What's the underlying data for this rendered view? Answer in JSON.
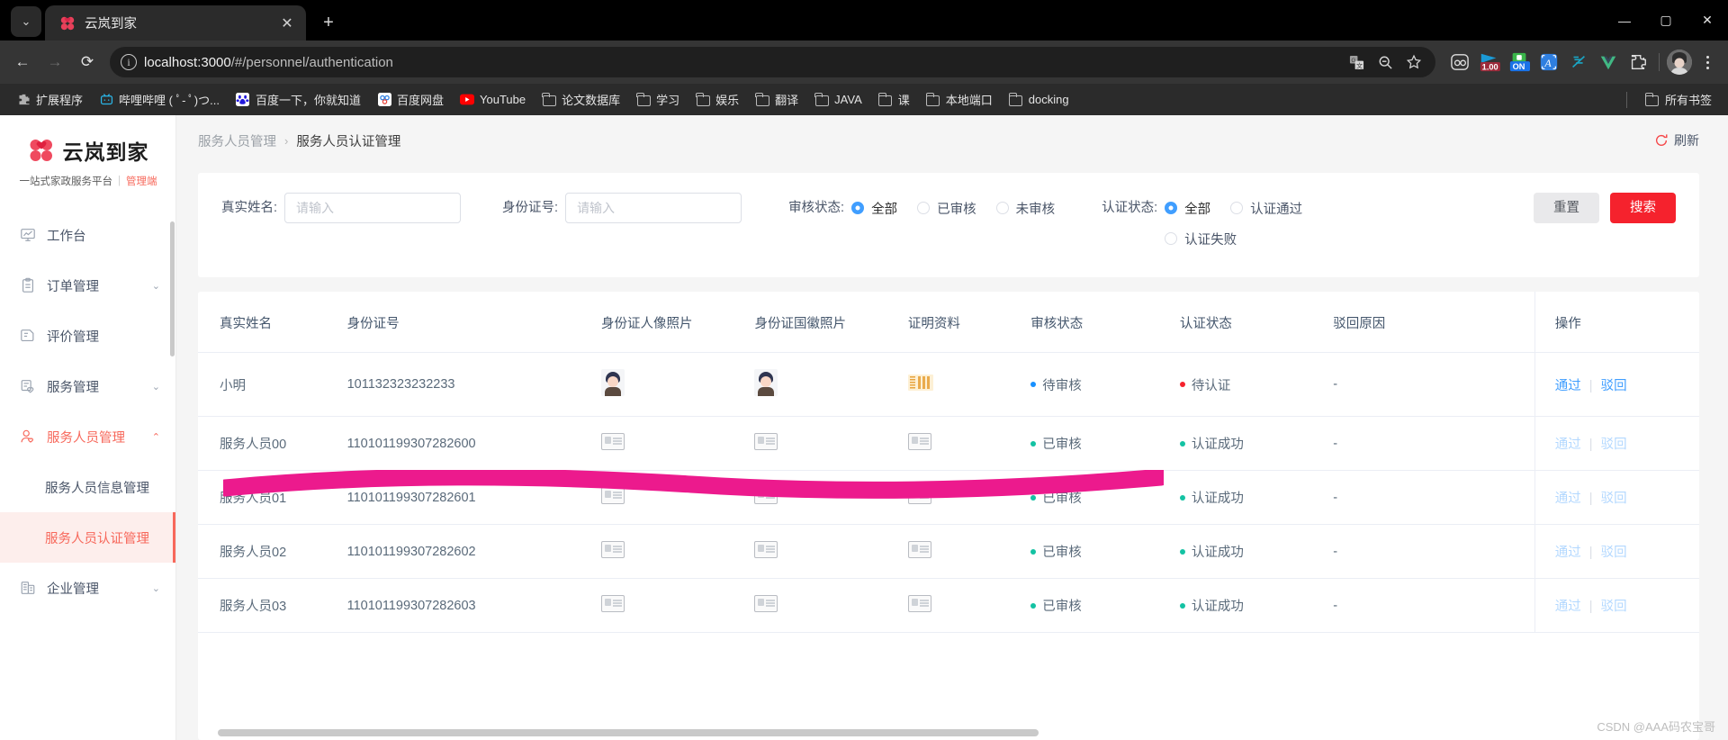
{
  "browser": {
    "tab": {
      "title": "云岚到家",
      "favicon": "clover-icon",
      "close_label": "✕"
    },
    "tab_list_icon": "chevron-down-icon",
    "newtab_label": "+",
    "window": {
      "minimize": "—",
      "maximize": "▢",
      "close": "✕"
    },
    "nav": {
      "back": "←",
      "forward": "→",
      "reload": "⟳"
    },
    "omnibox": {
      "info_icon": "info-circle-icon",
      "url_host": "localhost:3000",
      "url_path": "/#/personnel/authentication",
      "translate_icon": "translate-icon",
      "zoom_icon": "zoom-out-icon",
      "bookmark_icon": "star-icon"
    },
    "extensions": [
      {
        "name": "dual-circle-extension-icon",
        "badge": ""
      },
      {
        "name": "flag-extension-icon",
        "badge": "1.00"
      },
      {
        "name": "on-toggle-extension-icon",
        "badge": "ON"
      },
      {
        "name": "letter-a-extension-icon",
        "badge": ""
      },
      {
        "name": "paperclip-extension-icon",
        "badge": ""
      },
      {
        "name": "vue-devtools-extension-icon",
        "badge": ""
      },
      {
        "name": "puzzle-extensions-icon",
        "badge": ""
      }
    ],
    "profile_icon": "avatar",
    "menu_icon": "three-dots-icon",
    "bookmarks": [
      {
        "label": "扩展程序",
        "icon": "puzzle-icon"
      },
      {
        "label": "哔哩哔哩 ( ﾟ- ﾟ)つ...",
        "icon": "bilibili-icon"
      },
      {
        "label": "百度一下，你就知道",
        "icon": "baidu-icon"
      },
      {
        "label": "百度网盘",
        "icon": "baidu-pan-icon"
      },
      {
        "label": "YouTube",
        "icon": "youtube-icon"
      },
      {
        "label": "论文数据库",
        "icon": "folder-icon"
      },
      {
        "label": "学习",
        "icon": "folder-icon"
      },
      {
        "label": "娱乐",
        "icon": "folder-icon"
      },
      {
        "label": "翻译",
        "icon": "folder-icon"
      },
      {
        "label": "JAVA",
        "icon": "folder-icon"
      },
      {
        "label": "课",
        "icon": "folder-icon"
      },
      {
        "label": "本地端口",
        "icon": "folder-icon"
      },
      {
        "label": "docking",
        "icon": "folder-icon"
      }
    ],
    "all_bookmarks": {
      "label": "所有书签",
      "icon": "folder-icon"
    }
  },
  "sidebar": {
    "logo_text": "云岚到家",
    "logo_sub": "一站式家政服务平台",
    "logo_sub_sep": "|",
    "logo_admin": "管理端",
    "items": [
      {
        "label": "工作台",
        "icon": "dashboard-icon",
        "chevron": "",
        "active": false
      },
      {
        "label": "订单管理",
        "icon": "clipboard-icon",
        "chevron": "⌄",
        "active": false
      },
      {
        "label": "评价管理",
        "icon": "review-icon",
        "chevron": "",
        "active": false
      },
      {
        "label": "服务管理",
        "icon": "service-icon",
        "chevron": "⌄",
        "active": false
      },
      {
        "label": "服务人员管理",
        "icon": "user-settings-icon",
        "chevron": "⌃",
        "active": true
      }
    ],
    "submenu": [
      {
        "label": "服务人员信息管理",
        "selected": false
      },
      {
        "label": "服务人员认证管理",
        "selected": true
      }
    ],
    "bottom_item": {
      "label": "企业管理",
      "icon": "building-icon",
      "chevron": "⌄"
    }
  },
  "header": {
    "breadcrumb_parent": "服务人员管理",
    "breadcrumb_sep": "›",
    "breadcrumb_current": "服务人员认证管理",
    "refresh_label": "刷新",
    "refresh_icon": "refresh-icon"
  },
  "filters": {
    "name": {
      "label": "真实姓名:",
      "value": "",
      "placeholder": "请输入"
    },
    "idcard": {
      "label": "身份证号:",
      "value": "",
      "placeholder": "请输入"
    },
    "audit_status": {
      "label": "审核状态:",
      "options": [
        {
          "label": "全部",
          "checked": true
        },
        {
          "label": "已审核",
          "checked": false
        },
        {
          "label": "未审核",
          "checked": false
        }
      ]
    },
    "cert_status": {
      "label": "认证状态:",
      "options": [
        {
          "label": "全部",
          "checked": true
        },
        {
          "label": "认证通过",
          "checked": false
        },
        {
          "label": "认证失败",
          "checked": false
        }
      ]
    },
    "reset_label": "重置",
    "search_label": "搜索"
  },
  "table": {
    "columns": [
      "真实姓名",
      "身份证号",
      "身份证人像照片",
      "身份证国徽照片",
      "证明资料",
      "审核状态",
      "认证状态",
      "驳回原因",
      "操作"
    ],
    "rows": [
      {
        "name": "小明",
        "idcard": "101132323232233",
        "face_photo": "person-photo-thumb",
        "emblem_photo": "person-photo-thumb",
        "proof": "document-thumb",
        "audit_status": "待审核",
        "audit_color": "#1890ff",
        "cert_status": "待认证",
        "cert_color": "#f5222d",
        "reject_reason": "-",
        "ops": {
          "approve": "通过",
          "reject": "驳回",
          "enabled": true
        }
      },
      {
        "name": "服务人员00",
        "idcard": "110101199307282600",
        "face_photo": "idcard-thumb",
        "emblem_photo": "idcard-thumb",
        "proof": "idcard-thumb",
        "audit_status": "已审核",
        "audit_color": "#13c2a3",
        "cert_status": "认证成功",
        "cert_color": "#13c2a3",
        "reject_reason": "-",
        "ops": {
          "approve": "通过",
          "reject": "驳回",
          "enabled": false
        }
      },
      {
        "name": "服务人员01",
        "idcard": "110101199307282601",
        "face_photo": "idcard-thumb",
        "emblem_photo": "idcard-thumb",
        "proof": "idcard-thumb",
        "audit_status": "已审核",
        "audit_color": "#13c2a3",
        "cert_status": "认证成功",
        "cert_color": "#13c2a3",
        "reject_reason": "-",
        "ops": {
          "approve": "通过",
          "reject": "驳回",
          "enabled": false
        }
      },
      {
        "name": "服务人员02",
        "idcard": "110101199307282602",
        "face_photo": "idcard-thumb",
        "emblem_photo": "idcard-thumb",
        "proof": "idcard-thumb",
        "audit_status": "已审核",
        "audit_color": "#13c2a3",
        "cert_status": "认证成功",
        "cert_color": "#13c2a3",
        "reject_reason": "-",
        "ops": {
          "approve": "通过",
          "reject": "驳回",
          "enabled": false
        }
      },
      {
        "name": "服务人员03",
        "idcard": "110101199307282603",
        "face_photo": "idcard-thumb",
        "emblem_photo": "idcard-thumb",
        "proof": "idcard-thumb",
        "audit_status": "已审核",
        "audit_color": "#13c2a3",
        "cert_status": "认证成功",
        "cert_color": "#13c2a3",
        "reject_reason": "-",
        "ops": {
          "approve": "通过",
          "reject": "驳回",
          "enabled": false
        }
      }
    ]
  },
  "annotation": {
    "type": "magenta-highlight-stroke",
    "color": "#ec1a8d"
  },
  "watermark": "CSDN @AAA码农宝哥",
  "colors": {
    "brand_red": "#f7685b",
    "search_red": "#f5222d",
    "link_blue": "#409eff",
    "radio_blue": "#409eff",
    "success_green": "#13c2a3",
    "pending_blue": "#1890ff"
  }
}
